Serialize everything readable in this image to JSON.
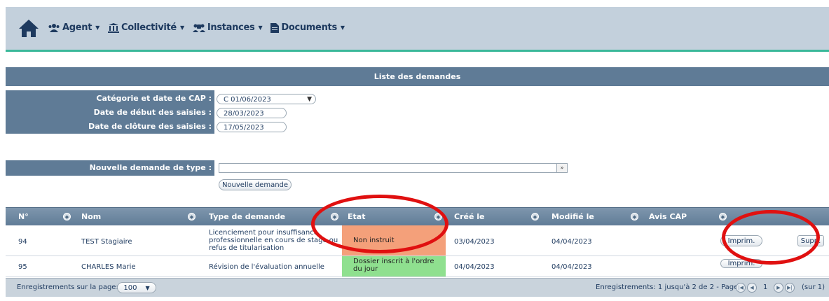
{
  "nav": {
    "items": [
      {
        "label": "Agent"
      },
      {
        "label": "Collectivité"
      },
      {
        "label": "Instances"
      },
      {
        "label": "Documents"
      }
    ]
  },
  "list_title": "Liste des demandes",
  "filters": {
    "cap_label": "Catégorie et date de CAP :",
    "cap_value": "C  01/06/2023",
    "start_label": "Date de début des saisies :",
    "start_value": "28/03/2023",
    "end_label": "Date de clôture des saisies :",
    "end_value": "17/05/2023"
  },
  "new_request": {
    "type_label": "Nouvelle demande de type :",
    "type_value": "",
    "button": "Nouvelle demande"
  },
  "table": {
    "headers": [
      "N°",
      "Nom",
      "Type de demande",
      "Etat",
      "Créé le",
      "Modifié le",
      "Avis CAP"
    ],
    "rows": [
      {
        "num": "94",
        "nom": "TEST Stagiaire",
        "type": "Licenciement pour insuffisance professionnelle en cours de stage ou refus de titularisation",
        "etat": "Non instruit",
        "etat_color": "#f4a07a",
        "cree": "03/04/2023",
        "modifie": "04/04/2023",
        "avis": "",
        "print_btn": "Imprim.",
        "delete_btn": "Supp."
      },
      {
        "num": "95",
        "nom": "CHARLES Marie",
        "type": "Révision de l'évaluation annuelle",
        "etat": "Dossier inscrit à l'ordre du jour",
        "etat_color": "#8fe08f",
        "cree": "04/04/2023",
        "modifie": "04/04/2023",
        "avis": "",
        "print_btn": "Imprim."
      }
    ]
  },
  "footer": {
    "per_page_label": "Enregistrements sur la page:",
    "per_page_value": "100",
    "records_info": "Enregistrements: 1 jusqu'à 2 de 2 - Pages:",
    "page": "1",
    "total": "(sur 1)"
  },
  "colors": {
    "accent": "#3bb89a",
    "header_bg": "#5f7b96",
    "annotation": "#e01010"
  }
}
